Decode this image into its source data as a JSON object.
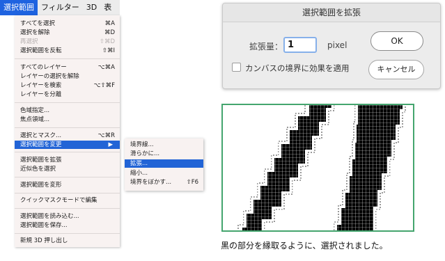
{
  "menubar": {
    "items": [
      {
        "label": "選択範囲",
        "active": true
      },
      {
        "label": "フィルター",
        "active": false
      },
      {
        "label": "3D",
        "active": false
      },
      {
        "label": "表",
        "active": false
      }
    ]
  },
  "menu": {
    "items": [
      {
        "label": "すべてを選択",
        "shortcut": "⌘A"
      },
      {
        "label": "選択を解除",
        "shortcut": "⌘D"
      },
      {
        "label": "再選択",
        "shortcut": "⇧⌘D",
        "disabled": true
      },
      {
        "label": "選択範囲を反転",
        "shortcut": "⇧⌘I"
      },
      {
        "label": "すべてのレイヤー",
        "shortcut": "⌥⌘A"
      },
      {
        "label": "レイヤーの選択を解除",
        "shortcut": ""
      },
      {
        "label": "レイヤーを検索",
        "shortcut": "⌥⇧⌘F"
      },
      {
        "label": "レイヤーを分離",
        "shortcut": ""
      },
      {
        "label": "色域指定...",
        "shortcut": ""
      },
      {
        "label": "焦点領域...",
        "shortcut": ""
      },
      {
        "label": "選択とマスク...",
        "shortcut": "⌥⌘R"
      },
      {
        "label": "選択範囲を変更",
        "shortcut": "▶",
        "highlighted": true
      },
      {
        "label": "選択範囲を拡張",
        "shortcut": ""
      },
      {
        "label": "近似色を選択",
        "shortcut": ""
      },
      {
        "label": "選択範囲を変形",
        "shortcut": ""
      },
      {
        "label": "クイックマスクモードで編集",
        "shortcut": ""
      },
      {
        "label": "選択範囲を読み込む...",
        "shortcut": ""
      },
      {
        "label": "選択範囲を保存...",
        "shortcut": ""
      },
      {
        "label": "新規 3D 押し出し",
        "shortcut": ""
      }
    ]
  },
  "submenu": {
    "items": [
      {
        "label": "境界線...",
        "shortcut": ""
      },
      {
        "label": "滑らかに...",
        "shortcut": ""
      },
      {
        "label": "拡張...",
        "shortcut": "",
        "highlighted": true
      },
      {
        "label": "縮小...",
        "shortcut": ""
      },
      {
        "label": "境界をぼかす...",
        "shortcut": "⇧F6"
      }
    ]
  },
  "dialog": {
    "title": "選択範囲を拡張",
    "amount_label": "拡張量：",
    "amount_value": "1",
    "unit": "pixel",
    "checkbox_label": "カンバスの境界に効果を適用",
    "checkbox_checked": false,
    "ok_label": "OK",
    "cancel_label": "キャンセル"
  },
  "caption": "黒の部分を縁取るように、選択されました。",
  "colors": {
    "highlight": "#2264d6",
    "menubar_active": "#1f63e0",
    "illustration_border": "#44a56e"
  }
}
